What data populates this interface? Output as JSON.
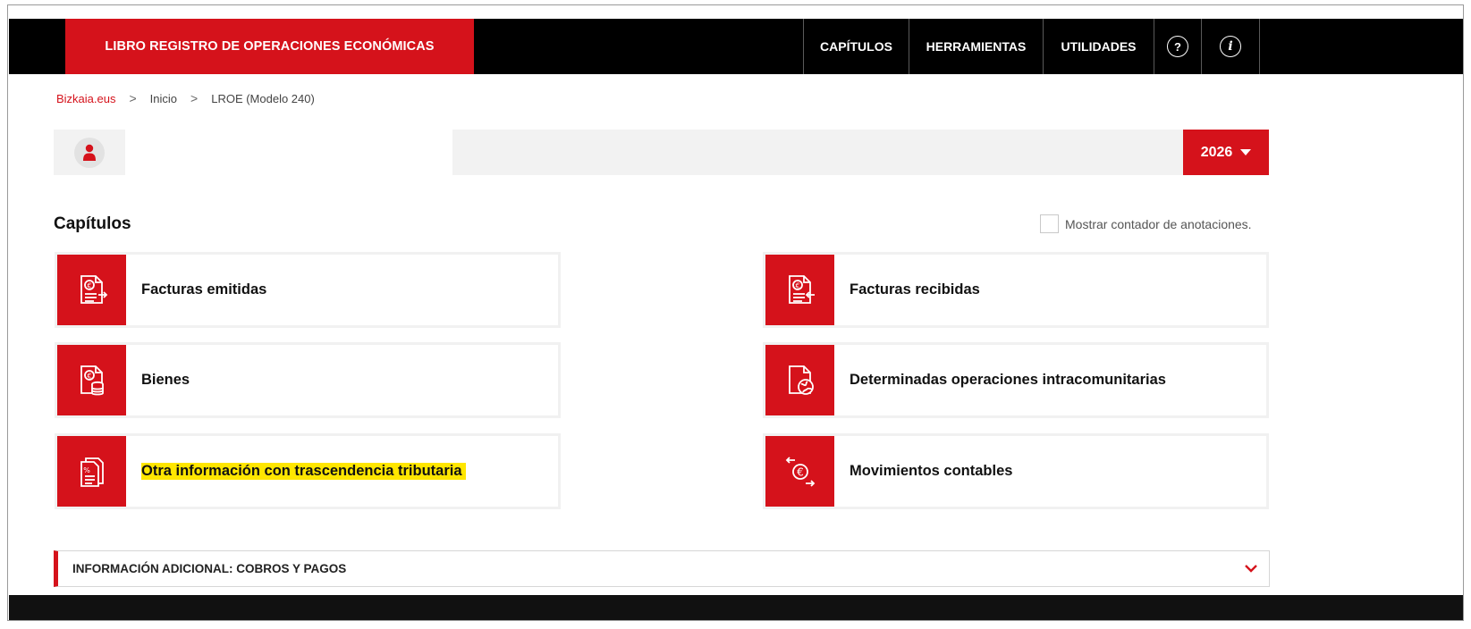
{
  "header": {
    "brand": "LIBRO REGISTRO DE OPERACIONES ECONÓMICAS",
    "nav": [
      {
        "label": "CAPÍTULOS"
      },
      {
        "label": "HERRAMIENTAS"
      },
      {
        "label": "UTILIDADES"
      }
    ],
    "help_glyph": "?",
    "info_glyph": "i"
  },
  "breadcrumb": {
    "items": [
      "Bizkaia.eus",
      "Inicio",
      "LROE (Modelo 240)"
    ],
    "separator": ">"
  },
  "year_selector": {
    "value": "2026"
  },
  "chapters": {
    "title": "Capítulos",
    "counter_label": "Mostrar contador de anotaciones.",
    "counter_checked": false,
    "cards": [
      {
        "label": "Facturas emitidas",
        "icon": "invoice-out-icon"
      },
      {
        "label": "Facturas recibidas",
        "icon": "invoice-in-icon"
      },
      {
        "label": "Bienes",
        "icon": "assets-icon"
      },
      {
        "label": "Determinadas operaciones intracomunitarias",
        "icon": "intracommunity-icon"
      },
      {
        "label": "Otra información con trascendencia tributaria",
        "icon": "tax-info-icon",
        "highlighted": true
      },
      {
        "label": "Movimientos contables",
        "icon": "accounting-movements-icon"
      }
    ]
  },
  "additional_info": {
    "label": "INFORMACIÓN ADICIONAL: COBROS Y PAGOS"
  },
  "colors": {
    "brand_red": "#d5121b",
    "highlight": "#ffe600",
    "topbar": "#000000"
  }
}
